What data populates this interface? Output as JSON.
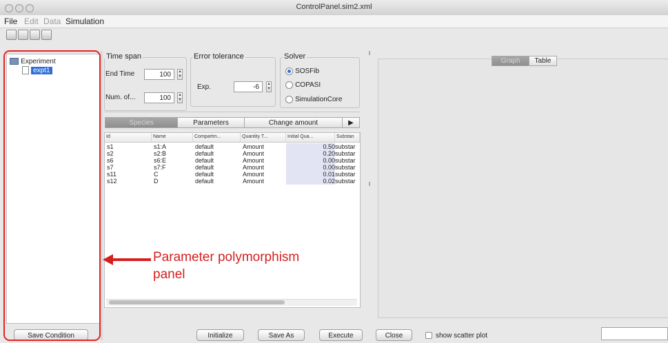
{
  "window": {
    "title": "ControlPanel.sim2.xml"
  },
  "menu": {
    "items": [
      "File",
      "Edit",
      "Data",
      "Simulation"
    ]
  },
  "tree": {
    "root_label": "Experiment",
    "child_label": "expt1",
    "save_condition_label": "Save Condition"
  },
  "time_span": {
    "legend": "Time span",
    "end_time_label": "End Time",
    "end_time_value": "100",
    "num_label": "Num. of...",
    "num_value": "100"
  },
  "error_tolerance": {
    "legend": "Error tolerance",
    "exp_label": "Exp.",
    "exp_value": "-6"
  },
  "solver": {
    "legend": "Solver",
    "options": [
      {
        "label": "SOSFib",
        "selected": true
      },
      {
        "label": "COPASI",
        "selected": false
      },
      {
        "label": "SimulationCore",
        "selected": false
      }
    ]
  },
  "tabs": {
    "species": "Species",
    "parameters": "Parameters",
    "change_amount": "Change amount",
    "more": "▶"
  },
  "species_table": {
    "headers": [
      "Id",
      "Name",
      "Compartm...",
      "Quantity T...",
      "Initial Qua...",
      "Substan"
    ],
    "rows": [
      [
        "s1",
        "s1:A",
        "default",
        "Amount",
        "0.50",
        "substar"
      ],
      [
        "s2",
        "s2:B",
        "default",
        "Amount",
        "0.20",
        "substar"
      ],
      [
        "s6",
        "s6:E",
        "default",
        "Amount",
        "0.00",
        "substar"
      ],
      [
        "s7",
        "s7:F",
        "default",
        "Amount",
        "0.00",
        "substar"
      ],
      [
        "s11",
        "C",
        "default",
        "Amount",
        "0.01",
        "substar"
      ],
      [
        "s12",
        "D",
        "default",
        "Amount",
        "0.02",
        "substar"
      ]
    ]
  },
  "right_tabs": {
    "graph": "Graph",
    "table": "Table"
  },
  "bottom": {
    "initialize": "Initialize",
    "save_as": "Save As",
    "execute": "Execute",
    "close": "Close",
    "scatter_label": "show scatter plot"
  },
  "annotation": {
    "line1": "Parameter polymorphism",
    "line2": "panel"
  },
  "colors": {
    "annotation": "#d61f1f",
    "selection": "#2f6fd6"
  }
}
